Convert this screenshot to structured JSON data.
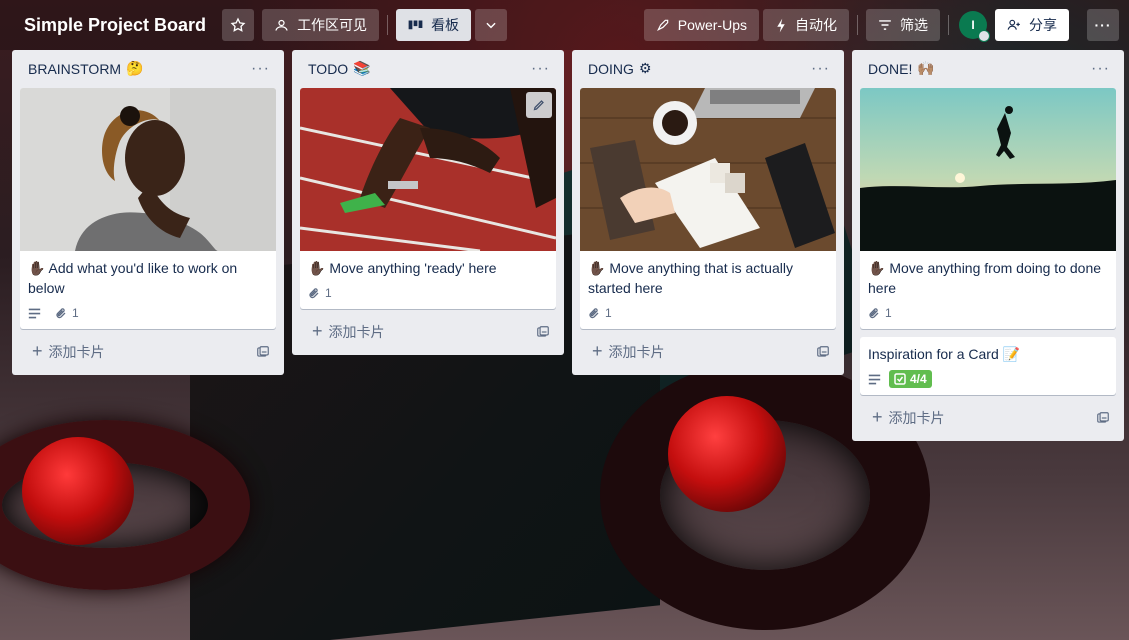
{
  "header": {
    "board_title": "Simple Project Board",
    "visibility_label": "工作区可见",
    "view_label": "看板",
    "powerups_label": "Power-Ups",
    "automation_label": "自动化",
    "filter_label": "筛选",
    "avatar_initial": "I",
    "share_label": "分享"
  },
  "lists": [
    {
      "title": "BRAINSTORM",
      "title_emoji": "🤔",
      "cards": [
        {
          "title": "✋🏿 Add what you'd like to work on below",
          "attachments": "1"
        }
      ],
      "add_card_label": "添加卡片"
    },
    {
      "title": "TODO",
      "title_emoji": "📚",
      "cards": [
        {
          "title": "✋🏿 Move anything 'ready' here",
          "attachments": "1"
        }
      ],
      "add_card_label": "添加卡片"
    },
    {
      "title": "DOING",
      "title_emoji": "⚙",
      "cards": [
        {
          "title": "✋🏿 Move anything that is actually started here",
          "attachments": "1"
        }
      ],
      "add_card_label": "添加卡片"
    },
    {
      "title": "DONE!",
      "title_emoji": "🙌🏽",
      "cards": [
        {
          "title": "✋🏿 Move anything from doing to done here",
          "attachments": "1"
        },
        {
          "title": "Inspiration for a Card 📝",
          "checklist": "4/4"
        }
      ],
      "add_card_label": "添加卡片"
    }
  ],
  "icons": {
    "list_menu": "···",
    "plus": "+",
    "more": "···"
  },
  "colors": {
    "list_bg": "#ebecf0",
    "checklist_complete": "#61bd4f",
    "avatar": "#0a7a50"
  }
}
